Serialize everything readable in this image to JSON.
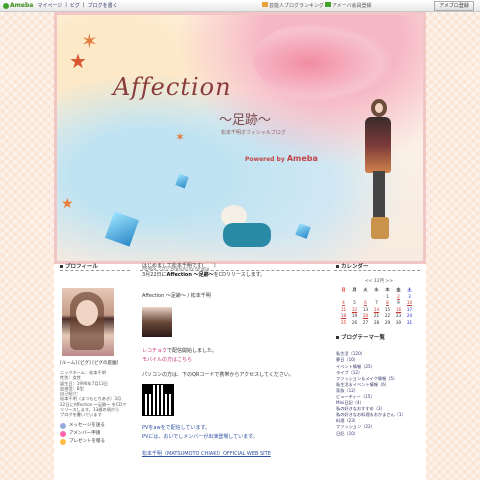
{
  "topbar": {
    "logo": "Ameba",
    "links": [
      "マイページ",
      "ピグ",
      "ブログを書く"
    ],
    "right_text": "芸能人ブログランキング",
    "right_text2": "アメーバ会員登録",
    "register_button": "アメブロ登録"
  },
  "header": {
    "title": "Affection",
    "subtitle": "〜足跡〜",
    "tagline": "松本千明オフィシャルブログ",
    "powered_label": "Powered by",
    "powered_brand": "Ameba",
    "url_line": "Ameba ブログ Powered by Ameba"
  },
  "left": {
    "profile_heading": "プロフィール",
    "meta_links": "[ルーム] [ピグ] [ピグの庭園]",
    "profile_text": "ニックネーム：松本千明\n性別：女性\n誕生日：1990年7月13日\n血液型：B型\n自己紹介：\n松本千明（まつもとちあき）3月\n22日にAffection 〜足跡〜 をCDで\nリリースします。13歳の頃から\nブログを書いています",
    "links": [
      "メッセージを送る",
      "アメンバー申請",
      "プレゼントを贈る"
    ]
  },
  "main": {
    "intro": "はじめまして松本千明です(＾＾)",
    "release_prefix": "3月22日に",
    "release_title": "Affection 〜足跡〜",
    "release_suffix": "をCDリリースします。",
    "cd_title": "Affection 〜足跡〜 / 松本千明",
    "blog_link": "レコチョク",
    "blog_link_suffix": "で配信開始しました。",
    "mobile_link": "モバイルの方はこちら",
    "qr_text": "パソコンの方は、下のQRコードで携帯からアクセスしてください。",
    "pv_link": "PVをawを",
    "pv_link_suffix": "で配信しています。",
    "pv2": "PVには、おいでしメンバーが出演登場しています。",
    "official_site": "松本千明（MATSUMOTO CHIAKI）OFFICIAL WEB SITE"
  },
  "right": {
    "calendar_heading": "カレンダー",
    "calendar_nav": "<< 12月 >>",
    "weekdays": [
      "日",
      "月",
      "火",
      "水",
      "木",
      "金",
      "土"
    ],
    "weeks": [
      [
        "",
        "",
        "",
        "",
        "1",
        "2",
        "3"
      ],
      [
        "4",
        "5",
        "6",
        "7",
        "8",
        "9",
        "10"
      ],
      [
        "11",
        "12",
        "13",
        "14",
        "15",
        "16",
        "17"
      ],
      [
        "18",
        "19",
        "20",
        "21",
        "22",
        "23",
        "24"
      ],
      [
        "25",
        "26",
        "27",
        "28",
        "29",
        "30",
        "31"
      ]
    ],
    "theme_heading": "ブログテーマ一覧",
    "themes": [
      "私生活（120）",
      "夢日（10）",
      "イベント情報（25）",
      "ライブ（12）",
      "ファッション＆メイク情報（5）",
      "私生活＆イベント情報（6）",
      "家族（12）",
      "ビューティー（15）",
      "Mixi日記（4）",
      "私の好きなおすすめ（3）",
      "私の好きなお料理＆おかまさん（1）",
      "料理（23）",
      "ファッション（22）",
      "日記（10）"
    ]
  }
}
